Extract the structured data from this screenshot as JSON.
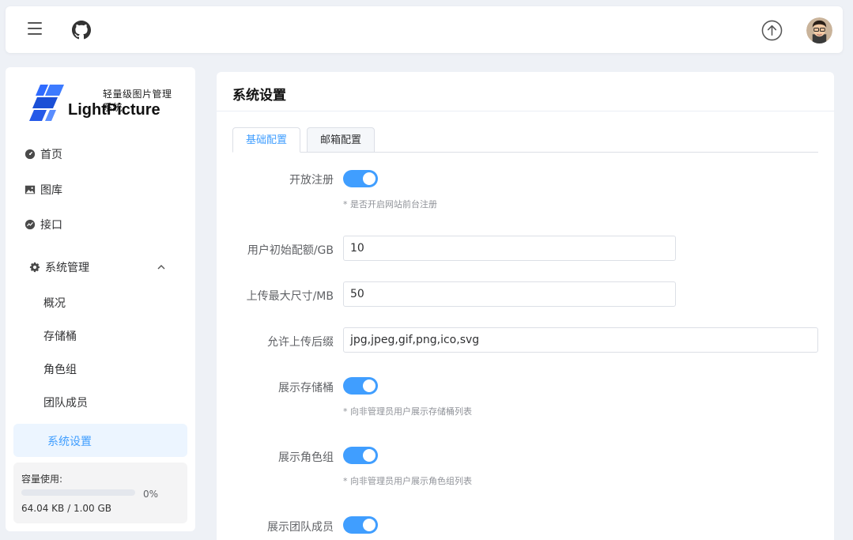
{
  "header": {
    "menu_icon": "hamburger-icon",
    "github_icon": "github-icon",
    "upload_icon": "upload-arrow-icon",
    "avatar_icon": "user-avatar"
  },
  "sidebar": {
    "logo_small": "轻量级图片管理系统",
    "logo_big": "LightPicture",
    "items": [
      {
        "label": "首页",
        "icon": "dashboard-icon"
      },
      {
        "label": "图库",
        "icon": "image-icon"
      },
      {
        "label": "接口",
        "icon": "api-icon"
      },
      {
        "label": "系统管理",
        "icon": "gear-icon"
      }
    ],
    "sub_items": [
      "概况",
      "存储桶",
      "角色组",
      "团队成员",
      "系统设置"
    ],
    "storage": {
      "label": "容量使用:",
      "percent": "0%",
      "progress": 0,
      "usage": "64.04 KB / 1.00 GB"
    }
  },
  "main": {
    "title": "系统设置",
    "tabs": [
      {
        "label": "基础配置",
        "active": true
      },
      {
        "label": "邮箱配置",
        "active": false
      }
    ],
    "form": {
      "open_register_label": "开放注册",
      "open_register_hint": "* 是否开启网站前台注册",
      "quota_label": "用户初始配额/GB",
      "quota_value": "10",
      "max_size_label": "上传最大尺寸/MB",
      "max_size_value": "50",
      "ext_label": "允许上传后缀",
      "ext_value": "jpg,jpeg,gif,png,ico,svg",
      "show_bucket_label": "展示存储桶",
      "show_bucket_hint": "* 向非管理员用户展示存储桶列表",
      "show_role_label": "展示角色组",
      "show_role_hint": "* 向非管理员用户展示角色组列表",
      "show_team_label": "展示团队成员"
    }
  },
  "colors": {
    "accent": "#409eff",
    "background": "#eef1f6"
  }
}
